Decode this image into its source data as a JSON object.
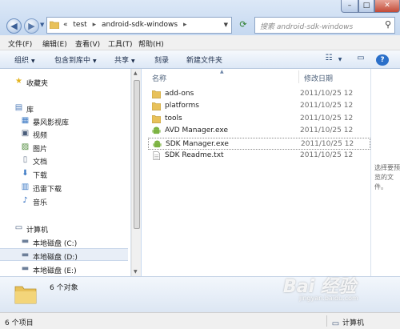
{
  "address": {
    "segments": [
      "«",
      "test",
      "android-sdk-windows"
    ],
    "search_placeholder": "搜索 android-sdk-windows"
  },
  "menu": [
    "文件(F)",
    "编辑(E)",
    "查看(V)",
    "工具(T)",
    "帮助(H)"
  ],
  "toolbar": {
    "organize": "组织",
    "include_library": "包含到库中",
    "share": "共享",
    "burn": "刻录",
    "new_folder": "新建文件夹"
  },
  "nav": {
    "favorites": "收藏夹",
    "libraries": "库",
    "library_items": [
      "暴风影视库",
      "视频",
      "图片",
      "文档",
      "下载",
      "迅雷下载",
      "音乐"
    ],
    "computer": "计算机",
    "drives": [
      "本地磁盘 (C:)",
      "本地磁盘 (D:)",
      "本地磁盘 (E:)"
    ]
  },
  "columns": {
    "name": "名称",
    "modified": "修改日期"
  },
  "files": [
    {
      "name": "add-ons",
      "date": "2011/10/25 12",
      "kind": "folder"
    },
    {
      "name": "platforms",
      "date": "2011/10/25 12",
      "kind": "folder"
    },
    {
      "name": "tools",
      "date": "2011/10/25 12",
      "kind": "folder"
    },
    {
      "name": "AVD Manager.exe",
      "date": "2011/10/25 12",
      "kind": "exe"
    },
    {
      "name": "SDK Manager.exe",
      "date": "2011/10/25 12",
      "kind": "exe"
    },
    {
      "name": "SDK Readme.txt",
      "date": "2011/10/25 12",
      "kind": "txt"
    }
  ],
  "preview": {
    "text": "选择要预览的文件。"
  },
  "details": {
    "count": "6 个对象"
  },
  "status": {
    "left": "6 个项目",
    "right": "计算机"
  },
  "watermark": {
    "main": "Bai 经验",
    "sub": "jingyan.baidu.com"
  },
  "colors": {
    "accent": "#c9daf0",
    "folder": "#e8c15a",
    "android": "#7cb342"
  }
}
